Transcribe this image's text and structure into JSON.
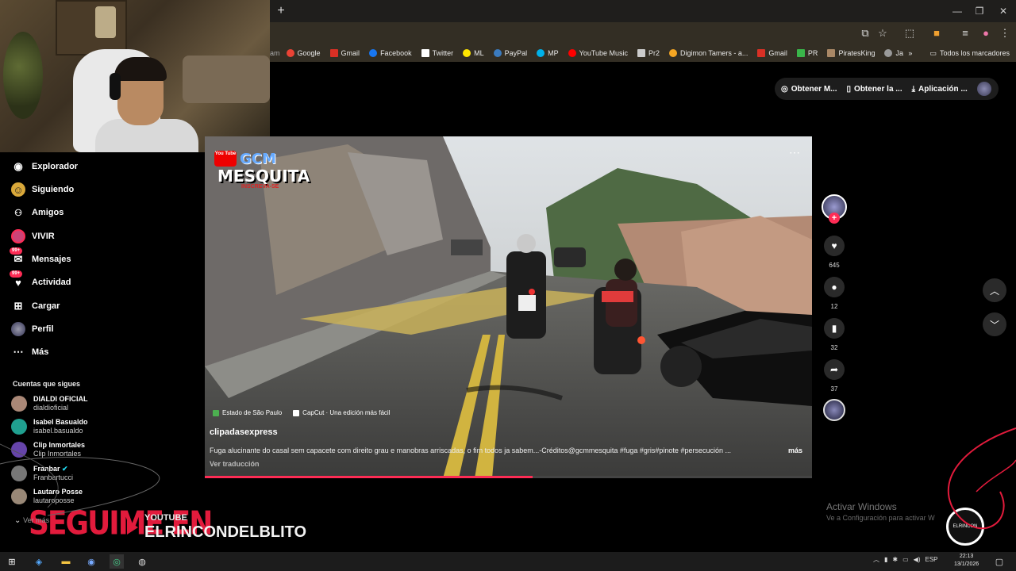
{
  "browser": {
    "new_tab": "+",
    "window_controls": [
      "—",
      "❐",
      "✕"
    ],
    "toolbar_icons": [
      "cast-icon",
      "star-icon",
      "extensions-icon",
      "profile-icon",
      "menu-icon"
    ],
    "bookmarks": [
      {
        "label": "Google",
        "color": "#ea4335"
      },
      {
        "label": "Gmail",
        "color": "#d93025"
      },
      {
        "label": "Facebook",
        "color": "#1877f2"
      },
      {
        "label": "Twitter",
        "color": "#ffffff"
      },
      {
        "label": "ML",
        "color": "#ffe600"
      },
      {
        "label": "PayPal",
        "color": "#003087"
      },
      {
        "label": "MP",
        "color": "#00b1ea"
      },
      {
        "label": "YouTube Music",
        "color": "#ff0000"
      },
      {
        "label": "Pr2",
        "color": "#cccccc"
      },
      {
        "label": "Digimon Tamers - a...",
        "color": "#f5a623"
      },
      {
        "label": "Gmail",
        "color": "#d93025"
      },
      {
        "label": "PR",
        "color": "#3ab54a"
      },
      {
        "label": "PiratesKing",
        "color": "#aa8866"
      },
      {
        "label": "Jam.ggdssds",
        "color": "#999999"
      }
    ],
    "bookmarks_overflow": "»",
    "all_bookmarks": "Todos los marcadores"
  },
  "top_actions": {
    "get_coins": "Obtener M...",
    "get_app": "Obtener la ...",
    "desktop_app": "Aplicación ..."
  },
  "sidebar": {
    "items": [
      {
        "label": "Explorador",
        "icon": "◉",
        "badge": ""
      },
      {
        "label": "Siguiendo",
        "icon": "☺",
        "badge": ""
      },
      {
        "label": "Amigos",
        "icon": "👥",
        "badge": ""
      },
      {
        "label": "VIVIR",
        "icon": "◍",
        "badge": ""
      },
      {
        "label": "Mensajes",
        "icon": "✉",
        "badge": "99+"
      },
      {
        "label": "Actividad",
        "icon": "♥",
        "badge": "99+"
      },
      {
        "label": "Cargar",
        "icon": "⊞",
        "badge": ""
      },
      {
        "label": "Perfil",
        "icon": "●",
        "badge": ""
      },
      {
        "label": "Más",
        "icon": "⋯",
        "badge": ""
      }
    ],
    "following_title": "Cuentas que sigues",
    "accounts": [
      {
        "name": "DIALDI OFICIAL",
        "handle": "dialdioficial",
        "color": "#aa8877"
      },
      {
        "name": "Isabel Basualdo",
        "handle": "isabel.basualdo",
        "color": "#20a090"
      },
      {
        "name": "Clip Inmortales",
        "handle": "Clip Inmortales",
        "color": "#6644aa"
      },
      {
        "name": "Franbar",
        "handle": "Franbartucci",
        "color": "#777777"
      },
      {
        "name": "Lautaro Posse",
        "handle": "lautaroposse",
        "color": "#998877"
      }
    ],
    "see_more": "Ver más"
  },
  "video": {
    "watermark_yt": "You Tube",
    "watermark_gcm": "GCM",
    "watermark_name": "MESQUITA",
    "watermark_sub": "INSCREVA-SE",
    "more": "⋯",
    "tags": [
      "Estado de São Paulo",
      "CapCut · Una edición más fácil"
    ],
    "author": "clipadasexpress",
    "description": "Fuga alucinante do casal sem capacete com direito grau e manobras arriscadas, o fim todos ja sabem...-Créditos@gcmmesquita #fuga #gris#pinote #persecución ...",
    "more_label": "más",
    "translate": "Ver traducción",
    "progress": 0.54
  },
  "actions": {
    "likes": "645",
    "comments": "12",
    "saves": "32",
    "shares": "37",
    "follow": "+"
  },
  "overlay": {
    "activate_title": "Activar Windows",
    "activate_sub": "Ve a Configuración para activar W",
    "seguime": "SEGUIME EN",
    "yt_small": "YOUTUBE",
    "channel": "ELRINCONDELBLITO",
    "channel_logo_text": "ELRINCON"
  },
  "taskbar": {
    "lang": "ESP",
    "time": "22:13",
    "date": "13/1/2026"
  }
}
